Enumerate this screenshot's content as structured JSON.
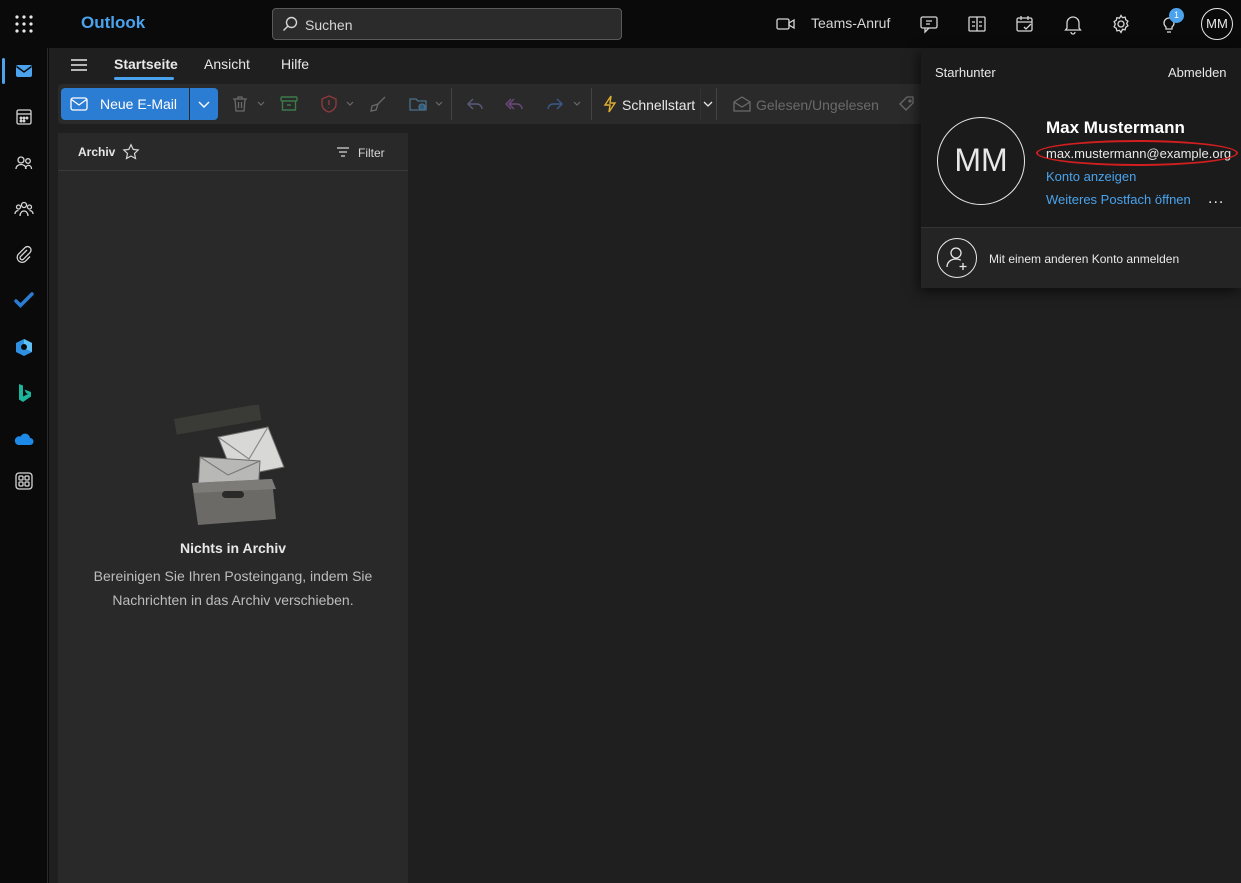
{
  "app": {
    "title": "Outlook"
  },
  "search": {
    "placeholder": "Suchen"
  },
  "topbar": {
    "teams_call_label": "Teams-Anruf",
    "tips_badge": "1",
    "avatar_initials": "MM"
  },
  "tabs": [
    {
      "label": "Startseite",
      "active": true
    },
    {
      "label": "Ansicht",
      "active": false
    },
    {
      "label": "Hilfe",
      "active": false
    }
  ],
  "ribbon": {
    "new_mail_label": "Neue E-Mail",
    "quickstart_label": "Schnellstart",
    "read_unread_label": "Gelesen/Ungelesen"
  },
  "folder": {
    "name": "Archiv",
    "filter_label": "Filter"
  },
  "empty_state": {
    "title": "Nichts in Archiv",
    "text": "Bereinigen Sie Ihren Posteingang, indem Sie Nachrichten in das Archiv verschieben."
  },
  "account": {
    "organization": "Starhunter",
    "sign_out_label": "Abmelden",
    "initials": "MM",
    "name": "Max Mustermann",
    "email": "max.mustermann@example.org",
    "view_account_label": "Konto anzeigen",
    "open_mailbox_label": "Weiteres Postfach öffnen",
    "more_label": "...",
    "other_account_label": "Mit einem anderen Konto anmelden"
  },
  "colors": {
    "accent": "#4aa3ec",
    "primary_button": "#2b7cd3",
    "annotation_red": "#d11f1f"
  }
}
